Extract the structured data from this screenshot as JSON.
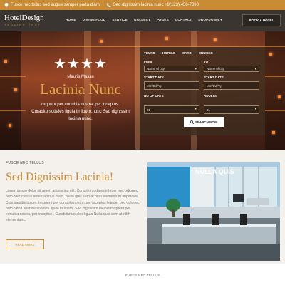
{
  "topbar": {
    "address": "Fusce nec tellus sed augue semper porta diam",
    "phone": "Sed dignissim lacinia nunc +9(123) 456-7890"
  },
  "logo": {
    "title": "HotelDesign",
    "subtitle": "TAGLINE TEXT"
  },
  "menu": [
    "HOME",
    "DINING FOOD",
    "SERVICE",
    "GALLERY",
    "PAGES",
    "CONTACT",
    "DROPDOWN ▾"
  ],
  "book_label": "BOOK A HOTEL",
  "hero": {
    "stars": "★★★★",
    "name": "Mauris Massa",
    "title": "Lacinia Nunc",
    "desc": "torquent per conubia nostra, per inceptos . Curabitursodales ligula in libero.nunc Sed dignissim lacinia nunc."
  },
  "booking": {
    "tabs": [
      "TOURS",
      "HOTELS",
      "CARS",
      "CRUISES"
    ],
    "from_label": "From",
    "to_label": "TO",
    "from_value": "Name of city",
    "to_value": "Name of city",
    "start_label": "START DATE",
    "start_label2": "START DATE",
    "date_placeholder": "Mm/Dd/Yy",
    "rooms_label": "NO OF DAYS",
    "adults_label": "ADULTS",
    "rooms_value": "01",
    "adults_value": "01",
    "search_label": "SEARCH NOW"
  },
  "about": {
    "pre": "FUSCE NEC TELLUS",
    "title": "Sed Dignissim Lacinia!",
    "text": "Lorem ipsum dolor sit amet, adipiscing elit. Curabitursodales integer nec odionec odio.Sed cursus ante dapibus diam. Nulla quis sem at nibh elementum imperdiet. Duis sagittis ipsum. torquent per conubia nostra, per inceptos Integer nec odionec odio.Sed Curabitursodales ligula in libero. Sed dignissim lacinia torquent per conubia nostra, per inceptos . Curabitursodales ligula Nulla quis sem at nibh elementum..",
    "read_more": "READ MORE"
  },
  "photo_title": "NULLA QUIS",
  "footer_pre": "FUSCE NEC TELLUS...",
  "colors": {
    "accent": "#c98c34",
    "nav": "#3a3530"
  }
}
